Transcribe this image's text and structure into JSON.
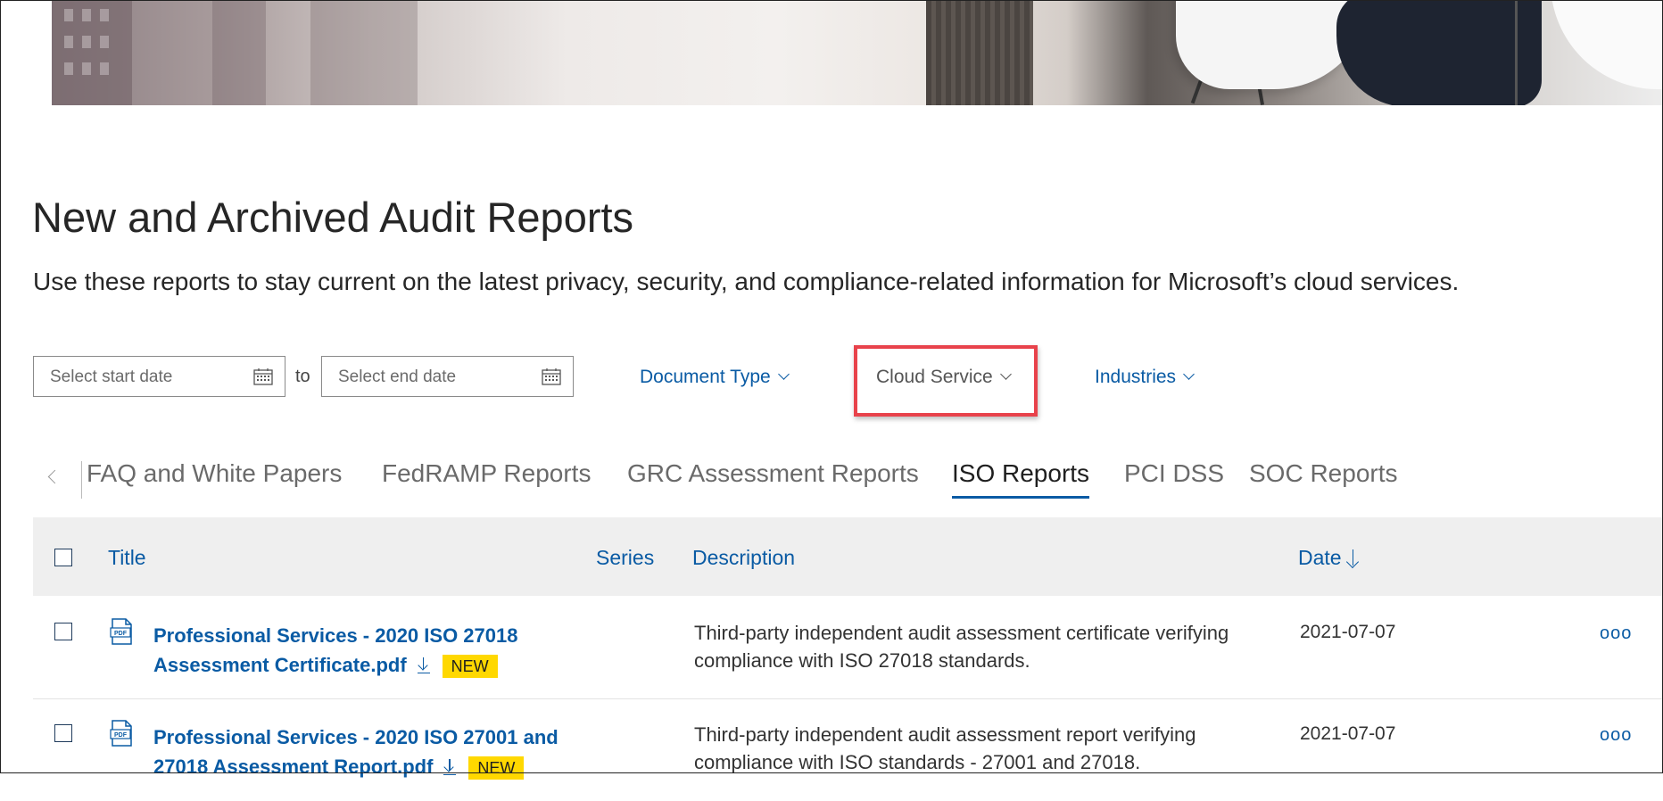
{
  "page": {
    "title": "New and Archived Audit Reports",
    "subtitle": "Use these reports to stay current on the latest privacy, security, and compliance-related information for Microsoft’s cloud services."
  },
  "filters": {
    "start_date_placeholder": "Select start date",
    "to_label": "to",
    "end_date_placeholder": "Select end date",
    "document_type": "Document Type",
    "cloud_service": "Cloud Service",
    "industries": "Industries"
  },
  "tabs": [
    {
      "label": "FAQ and White Papers",
      "active": false
    },
    {
      "label": "FedRAMP Reports",
      "active": false
    },
    {
      "label": "GRC Assessment Reports",
      "active": false
    },
    {
      "label": "ISO Reports",
      "active": true
    },
    {
      "label": "PCI DSS",
      "active": false
    },
    {
      "label": "SOC Reports",
      "active": false
    }
  ],
  "table": {
    "headers": {
      "title": "Title",
      "series": "Series",
      "description": "Description",
      "date": "Date"
    },
    "rows": [
      {
        "title": "Professional Services - 2020 ISO 27018 Assessment Certificate.pdf",
        "badge": "NEW",
        "description": "Third-party independent audit assessment certificate verifying compliance with ISO 27018 standards.",
        "date": "2021-07-07",
        "more": "ooo"
      },
      {
        "title": "Professional Services - 2020 ISO 27001 and 27018 Assessment Report.pdf",
        "badge": "NEW",
        "description": "Third-party independent audit assessment report verifying compliance with ISO standards - 27001 and 27018.",
        "date": "2021-07-07",
        "more": "ooo"
      }
    ]
  },
  "colors": {
    "accent": "#0a5ba4",
    "highlight": "#e8424b",
    "badge": "#ffd800",
    "header_bg": "#efefef"
  }
}
